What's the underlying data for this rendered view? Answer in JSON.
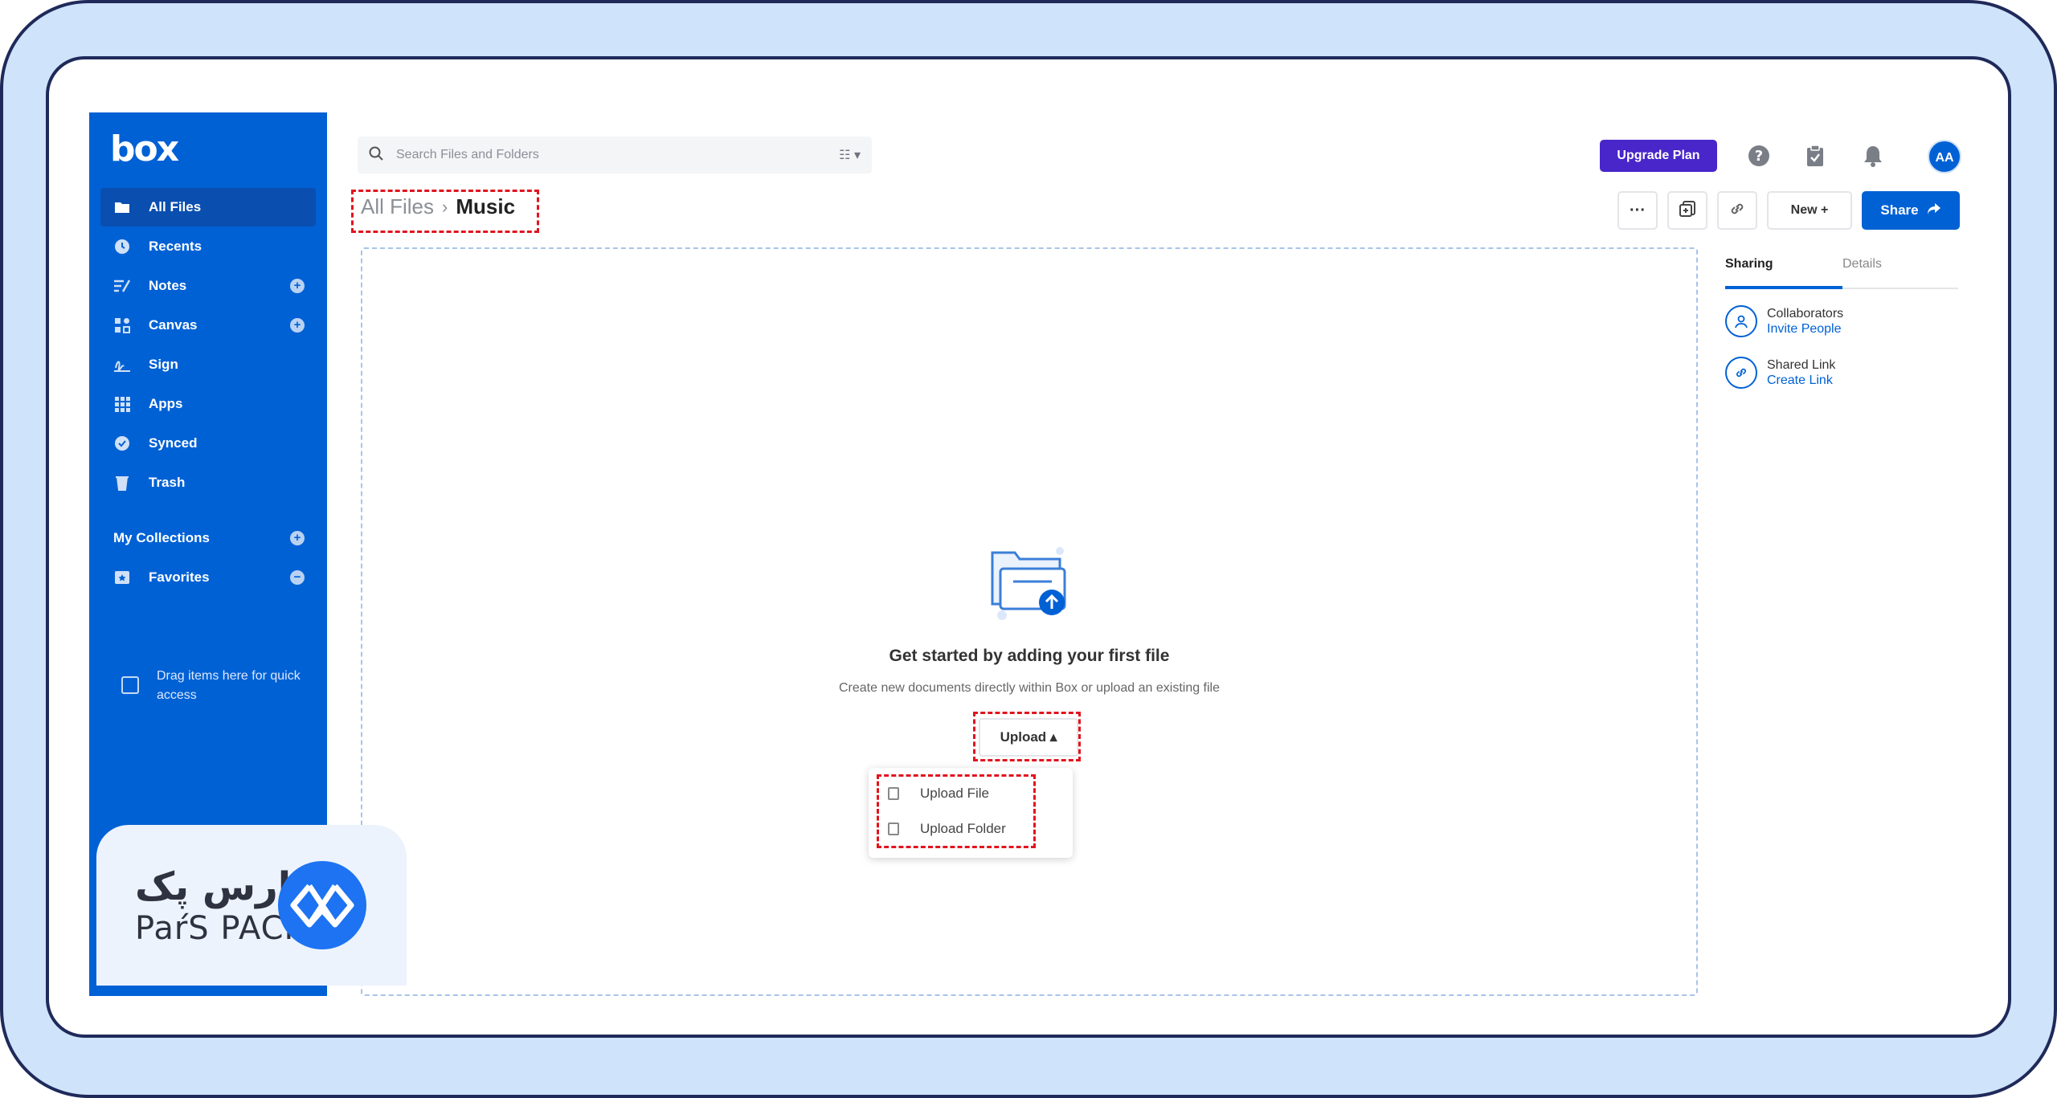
{
  "app": {
    "logo_text": "box"
  },
  "sidebar": {
    "items": [
      {
        "label": "All Files",
        "icon": "folder-icon"
      },
      {
        "label": "Recents",
        "icon": "clock-icon"
      },
      {
        "label": "Notes",
        "icon": "notes-icon"
      },
      {
        "label": "Canvas",
        "icon": "canvas-icon"
      },
      {
        "label": "Sign",
        "icon": "sign-icon"
      },
      {
        "label": "Apps",
        "icon": "apps-grid-icon"
      },
      {
        "label": "Synced",
        "icon": "check-circle-icon"
      },
      {
        "label": "Trash",
        "icon": "trash-icon"
      }
    ],
    "collections_label": "My Collections",
    "favorites_label": "Favorites",
    "drag_hint": "Drag items here for quick access"
  },
  "search": {
    "placeholder": "Search Files and Folders",
    "filter_label": "☷ ▾"
  },
  "header": {
    "upgrade_label": "Upgrade Plan",
    "avatar_initials": "AA"
  },
  "breadcrumb": {
    "root": "All Files",
    "separator": "›",
    "current": "Music"
  },
  "toolbar": {
    "more_label": "···",
    "new_label": "New +",
    "share_label": "Share"
  },
  "empty_state": {
    "title": "Get started by adding your first file",
    "subtitle": "Create new documents directly within Box or upload an existing file",
    "upload_label": "Upload ▴"
  },
  "upload_menu": {
    "upload_file": "Upload File",
    "upload_folder": "Upload Folder"
  },
  "side_panel": {
    "tabs": [
      "Sharing",
      "Details"
    ],
    "collaborators_title": "Collaborators",
    "collaborators_link": "Invite People",
    "shared_link_title": "Shared Link",
    "shared_link_link": "Create Link"
  },
  "watermark": {
    "brand_fa": "پارس پک",
    "brand_en": "PaŕS PACK"
  },
  "colors": {
    "box_blue": "#0061d5",
    "upgrade_purple": "#4826c9",
    "highlight_red": "#e1141e",
    "frame_bg": "#cfe3fb"
  }
}
